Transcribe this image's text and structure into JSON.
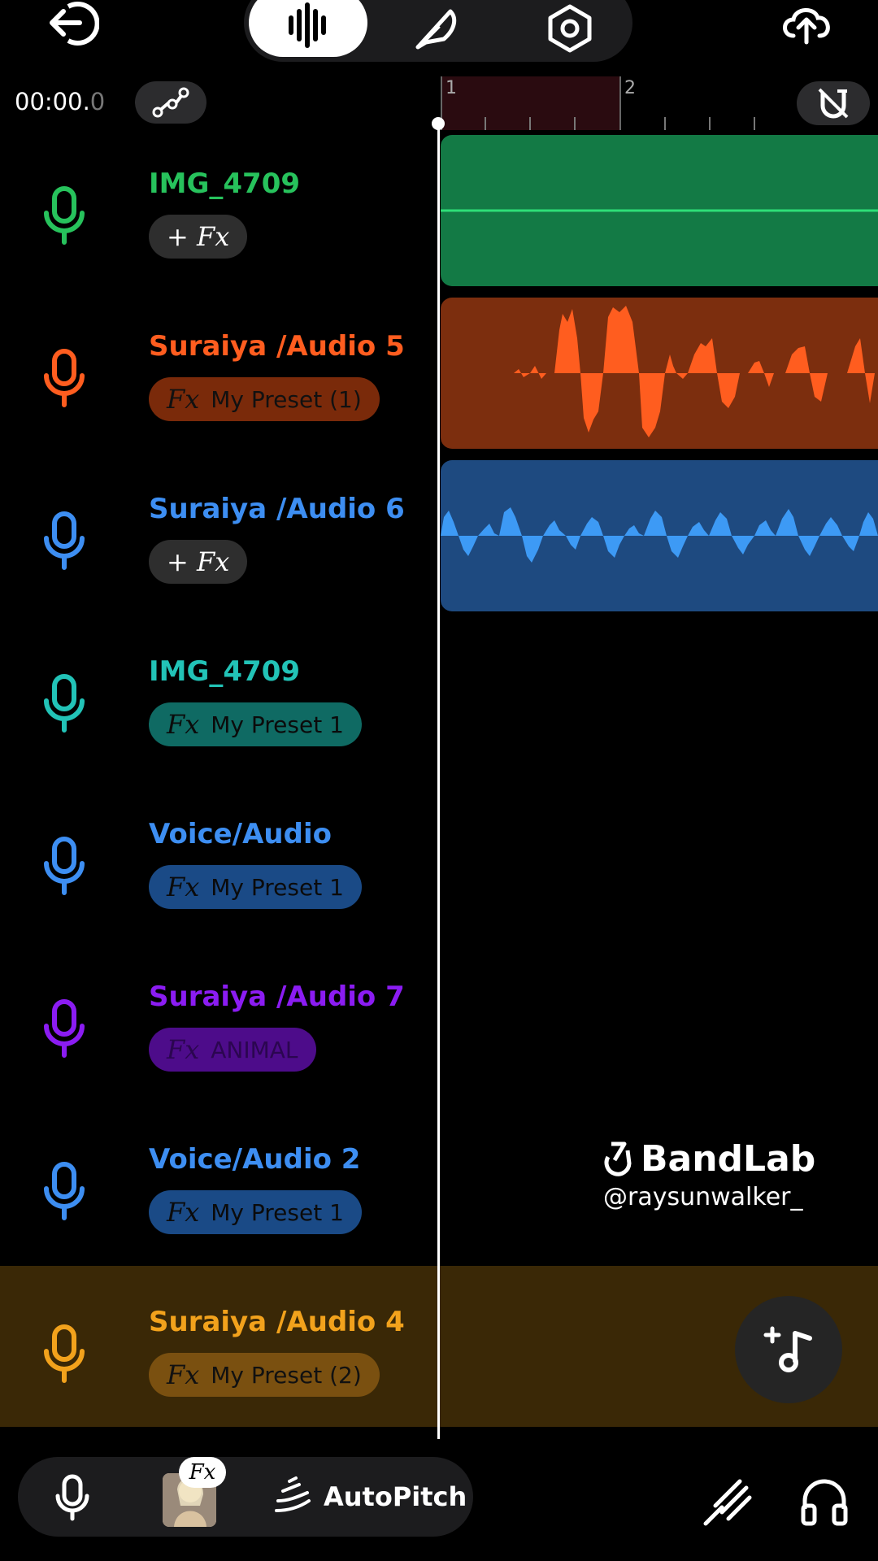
{
  "time": {
    "main": "00:00.",
    "fraction": "0"
  },
  "ruler": {
    "bar1": "1",
    "bar2": "2"
  },
  "tracks": [
    {
      "name": "IMG_4709",
      "color": "#27c25c",
      "fx_icon": "+ Fx",
      "fx_label": "",
      "pill_bg": "#2e2e2e",
      "fx_color": "#ffffff"
    },
    {
      "name": "Suraiya /Audio 5",
      "color": "#ff5d1f",
      "fx_icon": "Fx",
      "fx_label": "My Preset (1)",
      "pill_bg": "#7a2a0a",
      "fx_color": "#111111"
    },
    {
      "name": "Suraiya /Audio 6",
      "color": "#3d8ef2",
      "fx_icon": "+ Fx",
      "fx_label": "",
      "pill_bg": "#2e2e2e",
      "fx_color": "#ffffff"
    },
    {
      "name": "IMG_4709",
      "color": "#22c3b7",
      "fx_icon": "Fx",
      "fx_label": "My Preset 1",
      "pill_bg": "#0f6a63",
      "fx_color": "#0b0b0b"
    },
    {
      "name": "Voice/Audio",
      "color": "#3d8ef2",
      "fx_icon": "Fx",
      "fx_label": "My Preset 1",
      "pill_bg": "#1a4a86",
      "fx_color": "#0b0b0b"
    },
    {
      "name": "Suraiya /Audio 7",
      "color": "#8b1cf2",
      "fx_icon": "Fx",
      "fx_label": "ANIMAL",
      "pill_bg": "#4d0c8a",
      "fx_color": "#2b0650"
    },
    {
      "name": "Voice/Audio 2",
      "color": "#3d8ef2",
      "fx_icon": "Fx",
      "fx_label": "My Preset 1",
      "pill_bg": "#1a4a86",
      "fx_color": "#0b0b0b"
    },
    {
      "name": "Suraiya /Audio 4",
      "color": "#f2a21c",
      "fx_icon": "Fx",
      "fx_label": "My Preset (2)",
      "pill_bg": "#7a5010",
      "fx_color": "#111111"
    }
  ],
  "clips": [
    {
      "color": "#137a45",
      "wave": "#2edf78"
    },
    {
      "color": "#7c2e0e",
      "wave": "#ff5d1f"
    },
    {
      "color": "#1e4a80",
      "wave": "#3d9af5"
    }
  ],
  "brand": {
    "name": "BandLab",
    "handle": "@raysunwalker_"
  },
  "bottom": {
    "autopitch": "AutoPitch",
    "fx_badge": "Fx"
  },
  "icons": [
    "back-icon",
    "waveform-icon",
    "feather-icon",
    "settings-icon",
    "cloud-upload-icon",
    "automation-icon",
    "magnet-off-icon",
    "mic-icon",
    "add-music-icon",
    "autopitch-icon",
    "tuner-icon",
    "headphones-icon"
  ]
}
